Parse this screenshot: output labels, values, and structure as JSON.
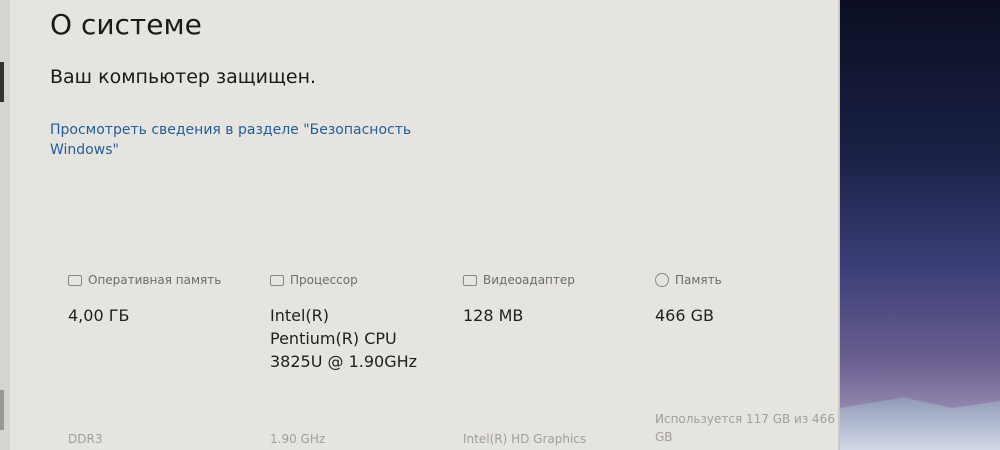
{
  "page": {
    "title": "О системе",
    "security_status": "Ваш компьютер защищен.",
    "security_link": "Просмотреть сведения в разделе \"Безопасность Windows\""
  },
  "specs": {
    "ram": {
      "label": "Оперативная память",
      "value": "4,00 ГБ",
      "sub": "DDR3",
      "icon": "memory-icon"
    },
    "cpu": {
      "label": "Процессор",
      "value": "Intel(R)\nPentium(R) CPU\n3825U @ 1.90GHz",
      "sub": "1.90 GHz",
      "icon": "processor-icon"
    },
    "gpu": {
      "label": "Видеоадаптер",
      "value": "128 MB",
      "sub": "Intel(R) HD Graphics",
      "icon": "video-adapter-icon"
    },
    "storage": {
      "label": "Память",
      "value": "466 GB",
      "sub": "Используется 117 GB из 466 GB",
      "icon": "storage-icon"
    }
  },
  "colors": {
    "window_bg": "#e6e4df",
    "link": "#1f5e9e",
    "text": "#1a1a1a",
    "label": "#6e6c69"
  }
}
